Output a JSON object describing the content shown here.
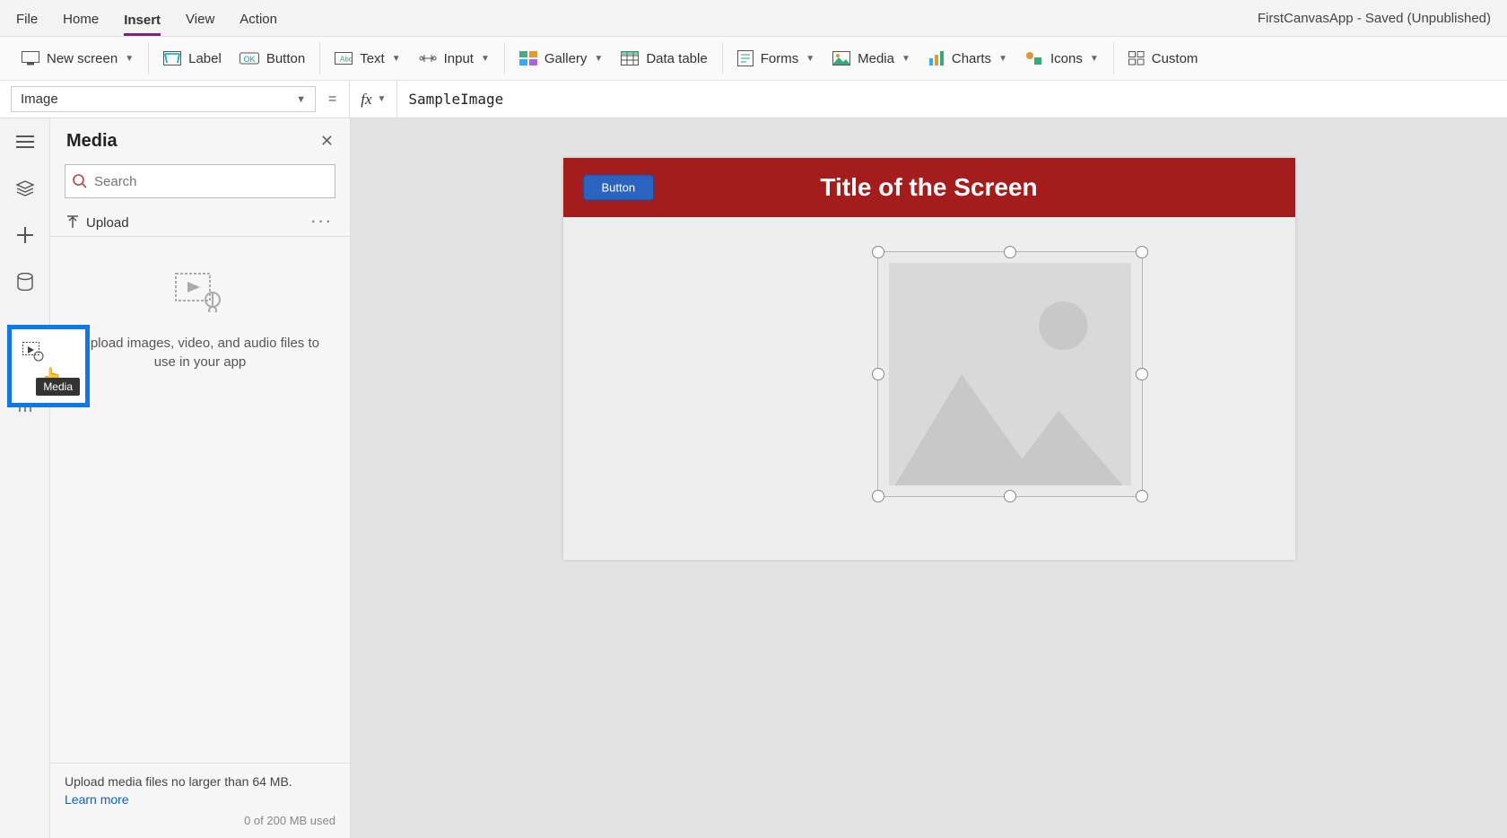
{
  "menu": {
    "file": "File",
    "home": "Home",
    "insert": "Insert",
    "view": "View",
    "action": "Action",
    "app_title": "FirstCanvasApp - Saved (Unpublished)"
  },
  "ribbon": {
    "new_screen": "New screen",
    "label": "Label",
    "button": "Button",
    "text": "Text",
    "input": "Input",
    "gallery": "Gallery",
    "data_table": "Data table",
    "forms": "Forms",
    "media": "Media",
    "charts": "Charts",
    "icons": "Icons",
    "custom": "Custom"
  },
  "formula": {
    "property": "Image",
    "value": "SampleImage"
  },
  "sidepanel": {
    "title": "Media",
    "search_placeholder": "Search",
    "upload": "Upload",
    "hint": "Upload images, video, and audio files to use in your app",
    "footer_text": "Upload media files no larger than 64 MB.",
    "learn_more": "Learn more",
    "usage": "0 of 200 MB used"
  },
  "leftrail": {
    "tooltip": "Media"
  },
  "canvas": {
    "button_label": "Button",
    "screen_title": "Title of the Screen"
  }
}
